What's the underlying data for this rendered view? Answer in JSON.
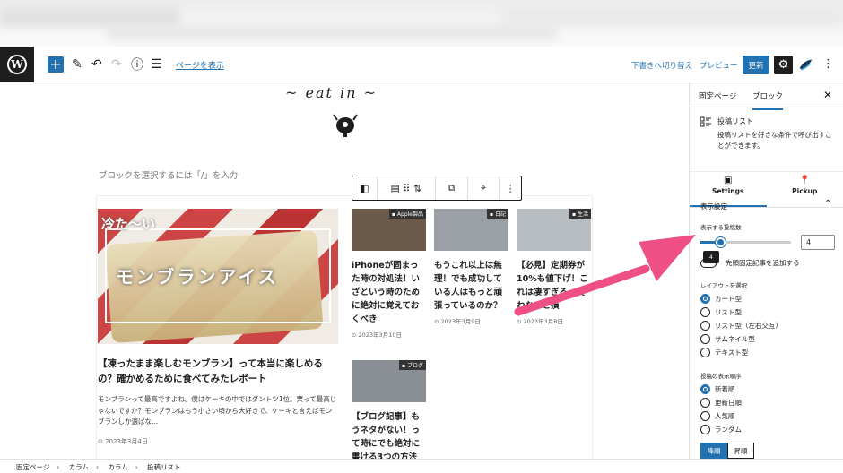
{
  "toolbar": {
    "view_page": "ページを表示",
    "draft_label": "下書きへ切り替え",
    "preview_label": "プレビュー",
    "update_label": "更新"
  },
  "canvas": {
    "logo_text": "~ eat in ~",
    "placeholder": "ブロックを選択するには「/」を入力"
  },
  "posts": {
    "big": {
      "thumb_top": "冷た〜い",
      "thumb_text": "モンブランアイス",
      "title": "【凍ったまま楽しむモンブラン】って本当に楽しめるの？確かめるために食べてみたレポート",
      "excerpt": "モンブランって最高ですよね。僕はケーキの中ではダントツ1位。栗って最高じゃないですか？モンブランはもう小さい頃から大好きで、ケーキと言えばモンブランしか選ばな...",
      "date": "2023年3月4日"
    },
    "small": [
      {
        "category": "Apple製品",
        "title": "iPhoneが固まった時の対処法！いざという時のために絶対に覚えておくべき",
        "date": "2023年3月10日",
        "bg": "#6b5a4a"
      },
      {
        "category": "日記",
        "title": "もうこれ以上は無理！でも成功している人はもっと頑張っているのか？",
        "date": "2023年3月9日",
        "bg": "#9aa0a6"
      },
      {
        "category": "生活",
        "title": "【必見】定期券が10%も値下げ！これは凄すぎる。使わないと損",
        "date": "2023年3月8日",
        "bg": "#b7bcc0"
      },
      {
        "category": "ブログ",
        "title": "【ブログ記事】もうネタがない！っ て時にでも絶対に書ける3つの方法",
        "date": "",
        "bg": "#8a8f96"
      }
    ]
  },
  "sidebar": {
    "tab_page": "固定ページ",
    "tab_block": "ブロック",
    "block_title": "投稿リスト",
    "block_desc": "投稿リストを好きな条件で呼び出すことができます。",
    "sub_settings": "Settings",
    "sub_pickup": "Pickup",
    "panel_title": "表示設定",
    "count_label": "表示する投稿数",
    "count_value": "4",
    "count_min": 1,
    "count_max": 24,
    "tooltip": "4",
    "sticky_label": "先頭固定記事を追加する",
    "layout_label": "レイアウトを選択",
    "layouts": [
      "カード型",
      "リスト型",
      "リスト型（左右交互）",
      "サムネイル型",
      "テキスト型"
    ],
    "layout_selected": 0,
    "order_label": "投稿の表示順序",
    "orders": [
      "新着順",
      "更新日順",
      "人気順",
      "ランダム"
    ],
    "order_selected": 0,
    "asc_label": "降順",
    "desc_label": "昇順"
  },
  "breadcrumb": [
    "固定ページ",
    "カラム",
    "カラム",
    "投稿リスト"
  ],
  "colors": {
    "accent": "#2271b1",
    "arrow": "#ee4f84",
    "dark": "#1e1e1e"
  }
}
